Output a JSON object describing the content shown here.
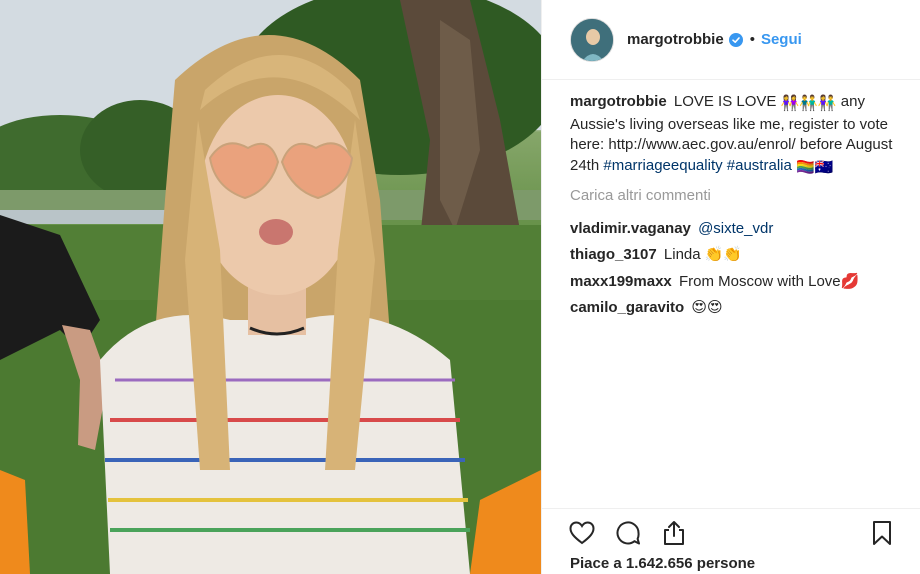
{
  "post": {
    "username": "margotrobbie",
    "verified": true,
    "follow_label": "Segui",
    "separator": "•"
  },
  "caption": {
    "user": "margotrobbie",
    "text_part1": "LOVE IS LOVE",
    "emoji_couples": "👭👬👫",
    "text_part2": "any Aussie's living overseas like me, register to vote here: http://www.aec.gov.au/enrol/ before August 24th",
    "hashtag1": "#marriageequality",
    "hashtag2": "#australia",
    "emoji_flags": "🏳️‍🌈🇦🇺"
  },
  "load_more_label": "Carica altri commenti",
  "comments": [
    {
      "user": "vladimir.vaganay",
      "text": "@sixte_vdr"
    },
    {
      "user": "thiago_3107",
      "text": "Linda 👏👏"
    },
    {
      "user": "maxx199maxx",
      "text": "From Moscow with Love💋"
    },
    {
      "user": "camilo_garavito",
      "text": "😍😍"
    }
  ],
  "likes_text": "Piace a 1.642.656 persone",
  "icons": {
    "like": "heart-icon",
    "comment": "comment-icon",
    "share": "share-icon",
    "save": "bookmark-icon",
    "verified": "verified-badge-icon"
  },
  "colors": {
    "accent_blue": "#3897f0",
    "hashtag": "#003569",
    "muted": "#999999",
    "text": "#262626"
  }
}
